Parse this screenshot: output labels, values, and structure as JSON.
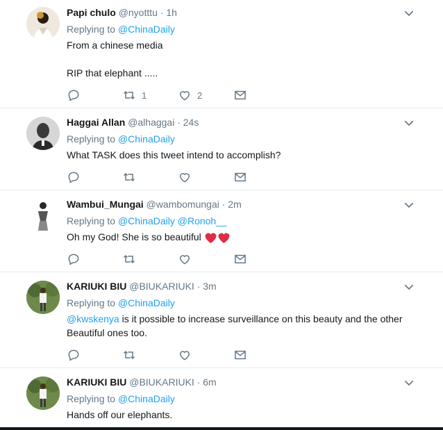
{
  "tweets": [
    {
      "name": "Papi chulo",
      "handle": "@nyotttu",
      "time": "· 1h",
      "replying_label": "Replying to",
      "replying_to": "@ChinaDaily",
      "replying_to_2": "",
      "body_line1": "From a chinese media",
      "body_line2": "RIP that elephant .....",
      "retweets": "1",
      "likes": "2"
    },
    {
      "name": "Haggai Allan",
      "handle": "@alhaggai",
      "time": "· 24s",
      "replying_label": "Replying to",
      "replying_to": "@ChinaDaily",
      "body_line1": "What TASK does this tweet intend to accomplish?"
    },
    {
      "name": "Wambui_Mungai",
      "handle": "@wambomungai",
      "time": "· 2m",
      "replying_label": "Replying to",
      "replying_to": "@ChinaDaily",
      "replying_to_2": "@Ronoh__",
      "body_line1": "Oh my God! She is so beautiful"
    },
    {
      "name": "KARIUKI BIU",
      "handle": "@BIUKARIUKI",
      "time": "· 3m",
      "replying_label": "Replying to",
      "replying_to": "@ChinaDaily",
      "mention": "@kwskenya",
      "body_line1": " is it possible to increase surveillance on this beauty and the other",
      "body_line2": "Beautiful ones too."
    },
    {
      "name": "KARIUKI BIU",
      "handle": "@BIUKARIUKI",
      "time": "· 6m",
      "replying_label": "Replying to",
      "replying_to": "@ChinaDaily",
      "body_line1": "Hands off our elephants."
    }
  ],
  "icons": {
    "reply": "reply-icon",
    "retweet": "retweet-icon",
    "like": "heart-icon",
    "dm": "envelope-icon",
    "menu": "chevron-down-icon",
    "emoji": "red-heart-emoji"
  },
  "colors": {
    "link": "#1da1f2",
    "muted": "#657786",
    "text": "#14171a",
    "divider": "#e6ecf0",
    "emoji_heart": "#dd2e44"
  }
}
